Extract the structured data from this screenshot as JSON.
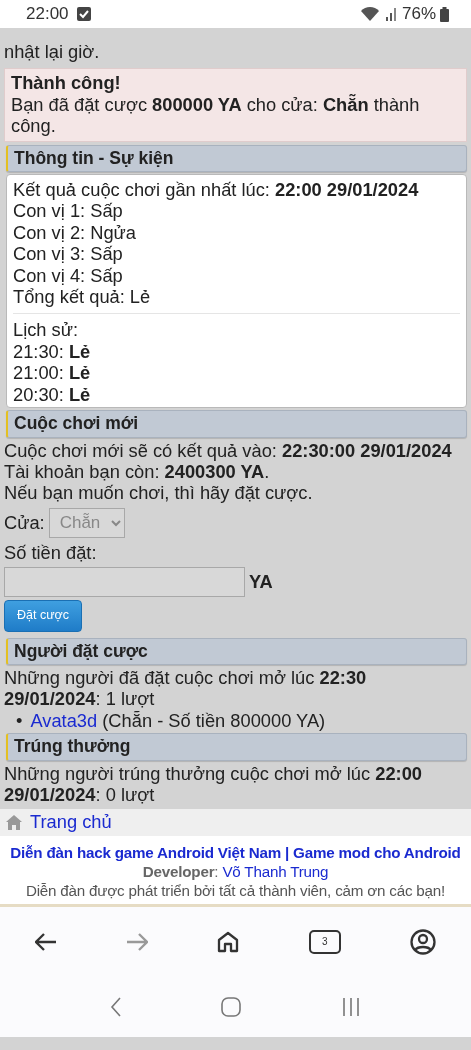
{
  "status_bar": {
    "time": "22:00",
    "battery": "76%"
  },
  "notice": {
    "text": "nhật lại giờ."
  },
  "alert": {
    "title": "Thành công!",
    "message": "Bạn đã đặt cược **800000 YA** cho cửa: **Chẵn** thành công."
  },
  "info": {
    "heading": "Thông tin - Sự kiện",
    "result_lines": [
      "Kết quả cuộc chơi gần nhất lúc: **22:00 29/01/2024**",
      "Con vị 1: Sấp",
      "Con vị 2: Ngửa",
      "Con vị 3: Sấp",
      "Con vị 4: Sấp",
      "Tổng kết quả: Lẻ"
    ],
    "history_label": "Lịch sử:",
    "history": [
      "21:30: **Lẻ**",
      "21:00: **Lẻ**",
      "20:30: **Lẻ**"
    ]
  },
  "new_game": {
    "heading": "Cuộc chơi mới",
    "lines": [
      "Cuộc chơi mới sẽ có kết quả vào: **22:30:00 29/01/2024**",
      "Tài khoản bạn còn: **2400300 YA**.",
      "Nếu bạn muốn chơi, thì hãy đặt cược."
    ],
    "door_label": "Cửa:",
    "door_select": {
      "value": "Chẵn",
      "disabled": true
    },
    "amount_label": "Số tiền đặt:",
    "unit": "YA",
    "submit": "Đặt cược"
  },
  "bettors": {
    "heading": "Người đặt cược",
    "summary": "Những người đã đặt cuộc chơi mở lúc **22:30 29/01/2024**: 1 lượt",
    "entries": [
      {
        "marker": "•",
        "user": "Avata3d",
        "detail": "(Chẵn - Số tiền 800000 YA)"
      }
    ]
  },
  "winners": {
    "heading": "Trúng thưởng",
    "summary": "Những người trúng thưởng cuộc chơi mở lúc **22:00 29/01/2024**: 0 lượt"
  },
  "home_link": "Trang chủ",
  "footer": {
    "site_title": "Diễn đàn hack game Android Việt Nam | Game mod cho Android",
    "developer_label": "**Developer**:",
    "developer_name": "Võ Thanh Trung",
    "thanks": "Diễn đàn được phát triển bởi tất cả thành viên, cảm ơn các bạn!"
  },
  "browser_nav": {
    "tab_count": "3",
    "forward_disabled": true
  }
}
